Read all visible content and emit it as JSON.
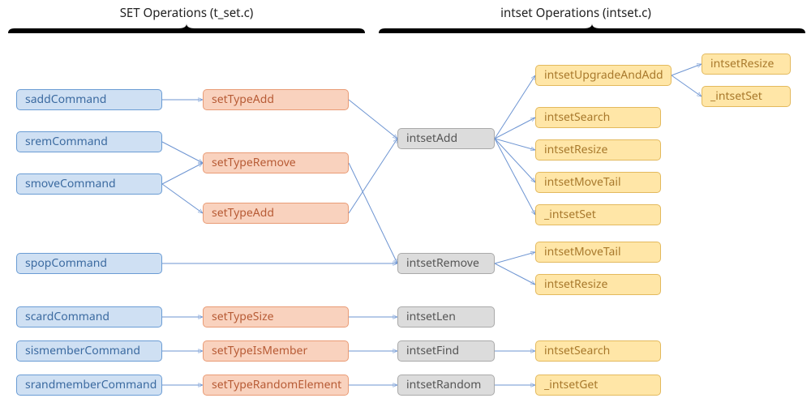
{
  "headers": {
    "left": "SET Operations (t_set.c)",
    "right": "intset Operations (intset.c)"
  },
  "colA": {
    "sadd": "saddCommand",
    "srem": "sremCommand",
    "smove": "smoveCommand",
    "spop": "spopCommand",
    "scard": "scardCommand",
    "sismember": "sismemberCommand",
    "srandmember": "srandmemberCommand"
  },
  "colB": {
    "add1": "setTypeAdd",
    "remove": "setTypeRemove",
    "add2": "setTypeAdd",
    "size": "setTypeSize",
    "ismember": "setTypeIsMember",
    "random": "setTypeRandomElement"
  },
  "colC": {
    "add": "intsetAdd",
    "remove": "intsetRemove",
    "len": "intsetLen",
    "find": "intsetFind",
    "random": "intsetRandom"
  },
  "colD": {
    "upgrade": "intsetUpgradeAndAdd",
    "search1": "intsetSearch",
    "resize1": "intsetResize",
    "movetail1": "intsetMoveTail",
    "set1": "_intsetSet",
    "movetail2": "intsetMoveTail",
    "resize2": "intsetResize",
    "search2": "intsetSearch",
    "get": "_intsetGet"
  },
  "colE": {
    "resize": "intsetResize",
    "set": "_intsetSet"
  },
  "edges": [
    [
      "sadd",
      "add1"
    ],
    [
      "srem",
      "remove"
    ],
    [
      "smove",
      "remove"
    ],
    [
      "smove",
      "add2"
    ],
    [
      "add1",
      "cAdd"
    ],
    [
      "remove",
      "cRemove"
    ],
    [
      "add2",
      "cAdd"
    ],
    [
      "spop",
      "cRemove"
    ],
    [
      "scard",
      "size"
    ],
    [
      "size",
      "cLen"
    ],
    [
      "sismember",
      "ismember"
    ],
    [
      "ismember",
      "cFind"
    ],
    [
      "srandmember",
      "random"
    ],
    [
      "random",
      "cRandom"
    ],
    [
      "cAdd",
      "dUpgrade"
    ],
    [
      "cAdd",
      "dSearch1"
    ],
    [
      "cAdd",
      "dResize1"
    ],
    [
      "cAdd",
      "dMovetail1"
    ],
    [
      "cAdd",
      "dSet1"
    ],
    [
      "cRemove",
      "dMovetail2"
    ],
    [
      "cRemove",
      "dResize2"
    ],
    [
      "cFind",
      "dSearch2"
    ],
    [
      "cRandom",
      "dGet"
    ],
    [
      "dUpgrade",
      "eResize"
    ],
    [
      "dUpgrade",
      "eSet"
    ]
  ]
}
